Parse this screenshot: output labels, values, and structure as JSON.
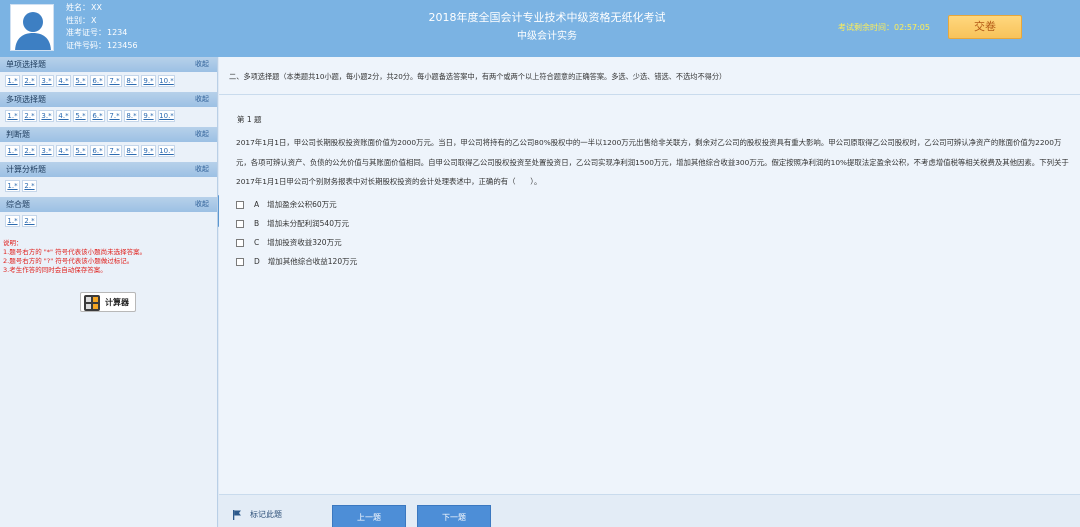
{
  "candidate": {
    "name_label": "姓名：",
    "name": "XX",
    "gender_label": "性别：",
    "gender": "X",
    "admission_label": "准考证号：",
    "admission": "1234",
    "id_label": "证件号码：",
    "id": "123456"
  },
  "exam": {
    "title": "2018年度全国会计专业技术中级资格无纸化考试",
    "subject": "中级会计实务",
    "timer_label": "考试剩余时间：",
    "timer_value": "02:57:05",
    "submit_label": "交卷"
  },
  "sidebar": {
    "collapse_label": "收起",
    "sections": [
      {
        "title": "单项选择题",
        "items": [
          "1.*",
          "2.*",
          "3.*",
          "4.*",
          "5.*",
          "6.*",
          "7.*",
          "8.*",
          "9.*",
          "10.*"
        ]
      },
      {
        "title": "多项选择题",
        "items": [
          "1.*",
          "2.*",
          "3.*",
          "4.*",
          "5.*",
          "6.*",
          "7.*",
          "8.*",
          "9.*",
          "10.*"
        ]
      },
      {
        "title": "判断题",
        "items": [
          "1.*",
          "2.*",
          "3.*",
          "4.*",
          "5.*",
          "6.*",
          "7.*",
          "8.*",
          "9.*",
          "10.*"
        ]
      },
      {
        "title": "计算分析题",
        "items": [
          "1.*",
          "2.*"
        ]
      },
      {
        "title": "综合题",
        "items": [
          "1.*",
          "2.*"
        ]
      }
    ],
    "notes": [
      "说明：",
      "1.题号右方的 \"*\" 符号代表该小题尚未选择答案。",
      "2.题号右方的 \"?\" 符号代表该小题做过标记。",
      "3.考生作答的同时会自动保存答案。"
    ],
    "calculator_label": "计算器"
  },
  "main": {
    "instruction": "二、多项选择题（本类题共10小题，每小题2分，共20分。每小题备选答案中，有两个或两个以上符合题意的正确答案。多选、少选、错选、不选均不得分）",
    "question_number": "第 1 题",
    "stem": "2017年1月1日，甲公司长期股权投资账面价值为2000万元。当日，甲公司将持有的乙公司80%股权中的一半以1200万元出售给非关联方，剩余对乙公司的股权投资具有重大影响。甲公司原取得乙公司股权时，乙公司可辨认净资产的账面价值为2200万元，各项可辨认资产、负债的公允价值与其账面价值相同。自甲公司取得乙公司股权投资至处置投资日，乙公司实现净利润1500万元，增加其他综合收益300万元。假定按照净利润的10%提取法定盈余公积，不考虑增值税等相关税费及其他因素。下列关于2017年1月1日甲公司个别财务报表中对长期股权投资的会计处理表述中，正确的有（　　）。",
    "options": [
      {
        "key": "A",
        "text": "增加盈余公积60万元"
      },
      {
        "key": "B",
        "text": "增加未分配利润540万元"
      },
      {
        "key": "C",
        "text": "增加投资收益320万元"
      },
      {
        "key": "D",
        "text": "增加其他综合收益120万元"
      }
    ]
  },
  "footer": {
    "mark_label": "标记此题",
    "prev_label": "上一题",
    "next_label": "下一题"
  },
  "colors": {
    "header_bg": "#7bb3e3",
    "submit_bg": "#f8c35a",
    "timer_text": "#ffef54",
    "nav_button": "#4d8ed7",
    "note_text": "#e0201c"
  }
}
